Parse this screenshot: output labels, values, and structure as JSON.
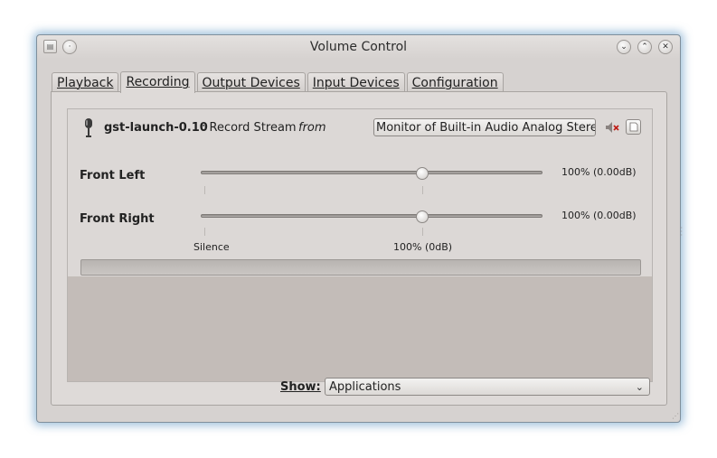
{
  "window": {
    "title": "Volume Control"
  },
  "titlebar_buttons": {
    "minimize_icon": "chevron-down-icon",
    "maximize_icon": "chevron-up-icon",
    "close_icon": "close-icon"
  },
  "tabs": [
    {
      "label": "Playback",
      "active": false
    },
    {
      "label": "Recording",
      "active": true
    },
    {
      "label": "Output Devices",
      "active": false
    },
    {
      "label": "Input Devices",
      "active": false
    },
    {
      "label": "Configuration",
      "active": false
    }
  ],
  "stream": {
    "app_name": "gst-launch-0.10",
    "stream_label": ": Record Stream",
    "from_label": "from",
    "source": "Monitor of Built-in Audio Analog Stereo",
    "channels": [
      {
        "label": "Front Left",
        "volume_text": "100% (0.00dB)",
        "level_percent": 100
      },
      {
        "label": "Front Right",
        "volume_text": "100% (0.00dB)",
        "level_percent": 100
      }
    ],
    "scale_labels": {
      "silence": "Silence",
      "full": "100% (0dB)"
    }
  },
  "footer": {
    "show_label": "Show:",
    "show_value": "Applications"
  },
  "colors": {
    "window_bg": "#d6d2d0",
    "glow": "#508cbe",
    "list_bg": "#c3bcb8"
  }
}
